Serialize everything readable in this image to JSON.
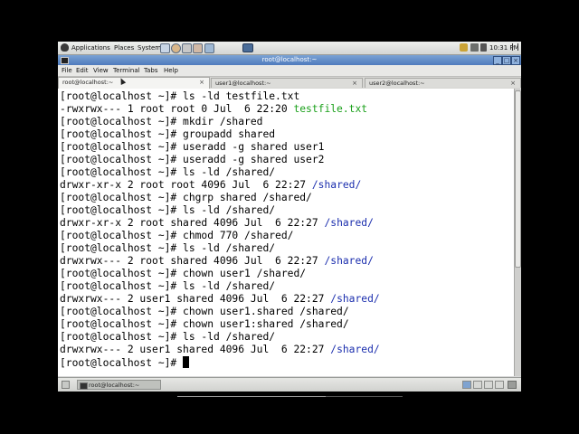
{
  "panel": {
    "applications": "Applications",
    "places": "Places",
    "system": "System",
    "clock": "10:31 PM"
  },
  "window": {
    "title": "root@localhost:~"
  },
  "menu": {
    "file": "File",
    "edit": "Edit",
    "view": "View",
    "terminal": "Terminal",
    "tabs": "Tabs",
    "help": "Help"
  },
  "tabs": [
    {
      "label": "root@localhost:~",
      "active": true
    },
    {
      "label": "user1@localhost:~",
      "active": false
    },
    {
      "label": "user2@localhost:~",
      "active": false
    }
  ],
  "terminal": {
    "lines": [
      {
        "text": "[root@localhost ~]# ls -ld testfile.txt"
      },
      {
        "text": "-rwxrwx--- 1 root root 0 Jul  6 22:20 ",
        "highlight": "testfile.txt",
        "color": "green"
      },
      {
        "text": "[root@localhost ~]# mkdir /shared"
      },
      {
        "text": "[root@localhost ~]# groupadd shared"
      },
      {
        "text": "[root@localhost ~]# useradd -g shared user1"
      },
      {
        "text": "[root@localhost ~]# useradd -g shared user2"
      },
      {
        "text": "[root@localhost ~]# ls -ld /shared/"
      },
      {
        "text": "drwxr-xr-x 2 root root 4096 Jul  6 22:27 ",
        "highlight": "/shared/",
        "color": "blue"
      },
      {
        "text": "[root@localhost ~]# chgrp shared /shared/"
      },
      {
        "text": "[root@localhost ~]# ls -ld /shared/"
      },
      {
        "text": "drwxr-xr-x 2 root shared 4096 Jul  6 22:27 ",
        "highlight": "/shared/",
        "color": "blue"
      },
      {
        "text": "[root@localhost ~]# chmod 770 /shared/"
      },
      {
        "text": "[root@localhost ~]# ls -ld /shared/"
      },
      {
        "text": "drwxrwx--- 2 root shared 4096 Jul  6 22:27 ",
        "highlight": "/shared/",
        "color": "blue"
      },
      {
        "text": "[root@localhost ~]# chown user1 /shared/"
      },
      {
        "text": "[root@localhost ~]# ls -ld /shared/"
      },
      {
        "text": "drwxrwx--- 2 user1 shared 4096 Jul  6 22:27 ",
        "highlight": "/shared/",
        "color": "blue"
      },
      {
        "text": "[root@localhost ~]# chown user1.shared /shared/"
      },
      {
        "text": "[root@localhost ~]# chown user1:shared /shared/"
      },
      {
        "text": "[root@localhost ~]# ls -ld /shared/"
      },
      {
        "text": "drwxrwx--- 2 user1 shared 4096 Jul  6 22:27 ",
        "highlight": "/shared/",
        "color": "blue"
      },
      {
        "text": "[root@localhost ~]# ",
        "cursor": true
      }
    ]
  },
  "taskbar": {
    "window_button": "root@localhost:~"
  },
  "colors": {
    "green": "#1aa01a",
    "blue": "#1c2fae",
    "title_bar": "#5a86c5"
  },
  "video_progress": 0.66
}
